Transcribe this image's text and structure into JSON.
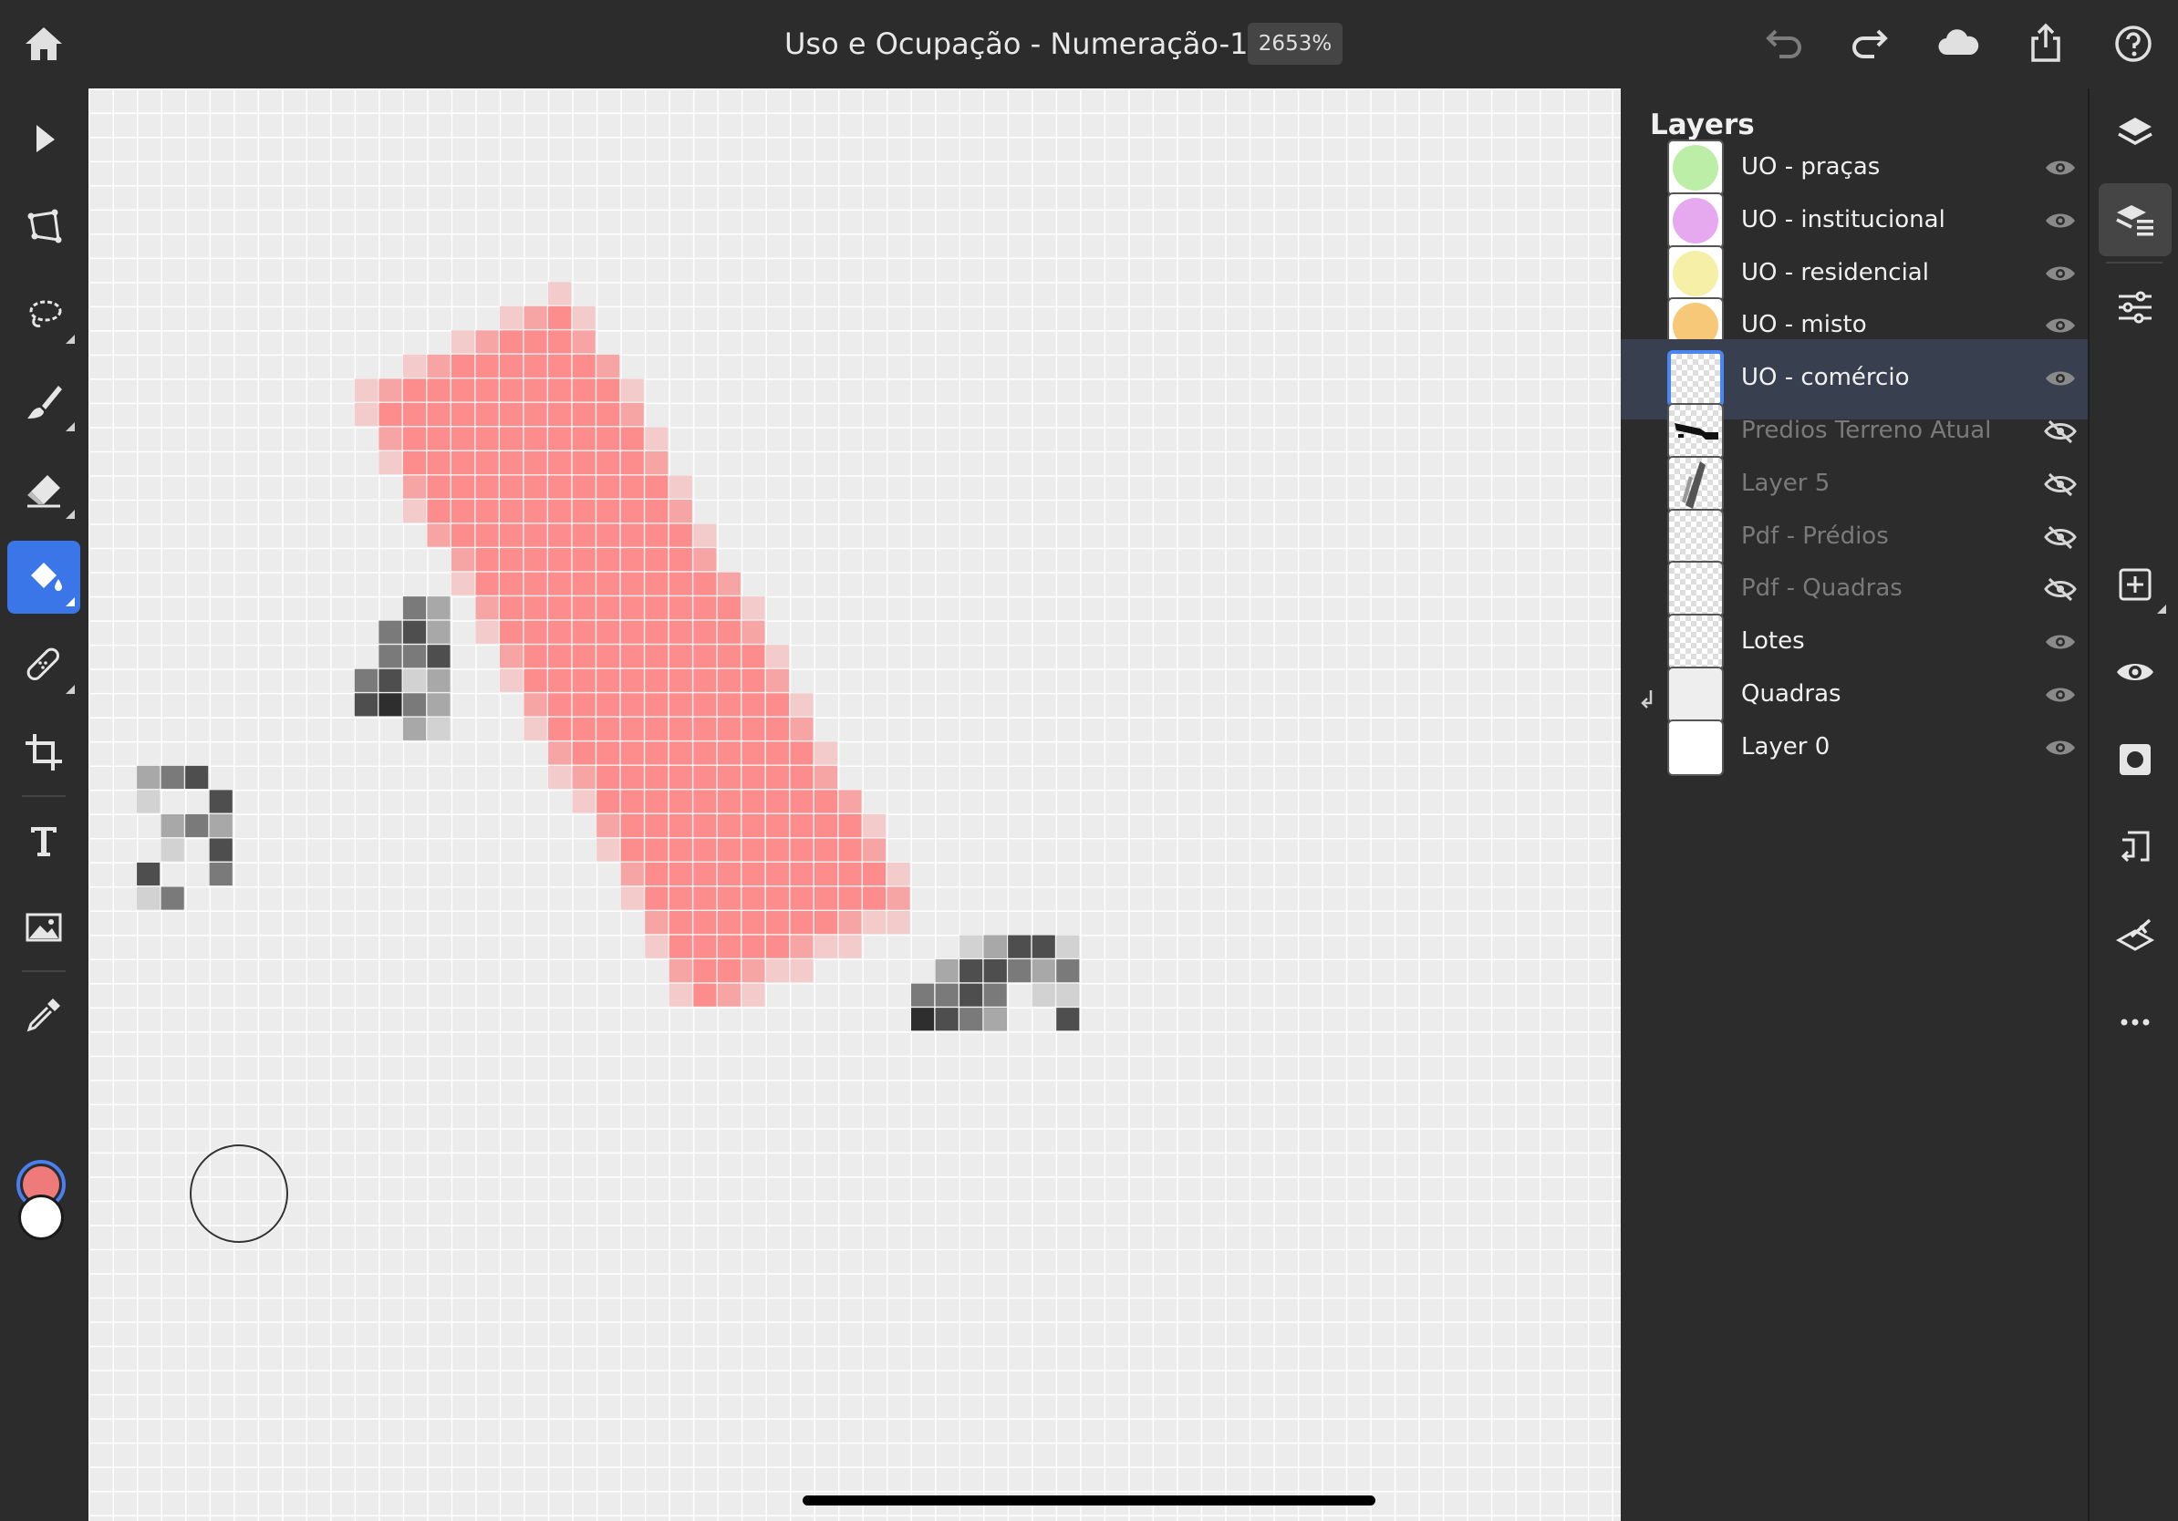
{
  "document": {
    "title": "Uso e Ocupação - Numeração-1",
    "zoom": "2653%"
  },
  "top_actions": [
    "undo-icon",
    "redo-icon",
    "cloud-icon",
    "share-icon",
    "help-icon"
  ],
  "tools": [
    "select-icon",
    "transform-icon",
    "lasso-icon",
    "brush-icon",
    "eraser-icon",
    "fill-icon",
    "heal-icon",
    "crop-icon",
    "text-icon",
    "image-icon",
    "eyedropper-icon"
  ],
  "active_tool": "fill-icon",
  "colors": {
    "primary": "#ee7b79",
    "secondary": "#ffffff",
    "accent": "#3a76e8",
    "fill_pixels": "#fd8c8c"
  },
  "layers_panel": {
    "title": "Layers",
    "layers": [
      {
        "name": "UO - praças",
        "visible": true,
        "thumb_color": "#bdeea7"
      },
      {
        "name": "UO - institucional",
        "visible": true,
        "thumb_color": "#e6a9f0"
      },
      {
        "name": "UO - residencial",
        "visible": true,
        "thumb_color": "#f5efa8"
      },
      {
        "name": "UO - misto",
        "visible": true,
        "thumb_color": "#f7c877"
      },
      {
        "name": "UO - comércio",
        "visible": true,
        "selected": true
      },
      {
        "name": "Predios Terreno Atual",
        "visible": false
      },
      {
        "name": "Layer 5",
        "visible": false,
        "clipped": true
      },
      {
        "name": "Pdf - Prédios",
        "visible": false
      },
      {
        "name": "Pdf - Quadras",
        "visible": false
      },
      {
        "name": "Lotes",
        "visible": true
      },
      {
        "name": "Quadras",
        "visible": true
      },
      {
        "name": "Layer 0",
        "visible": true
      }
    ]
  },
  "right_rail": [
    "layers-icon",
    "layer-properties-icon",
    "adjustments-icon",
    "add-layer-icon",
    "visibility-icon",
    "mask-icon",
    "merge-down-icon",
    "clear-layer-icon",
    "more-icon"
  ]
}
